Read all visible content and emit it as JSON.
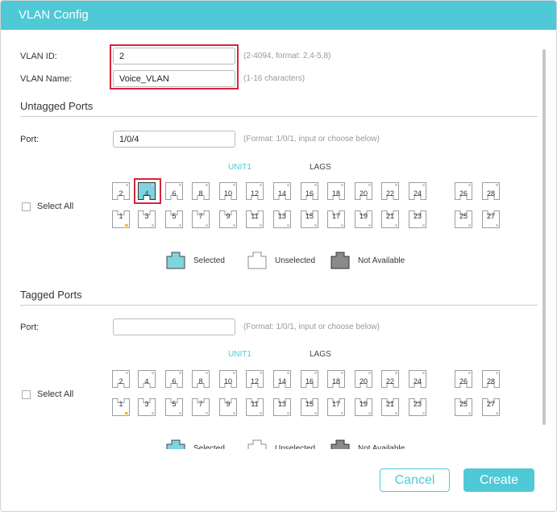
{
  "dialog": {
    "title": "VLAN Config"
  },
  "vlan_id": {
    "label": "VLAN ID:",
    "value": "2",
    "hint": "(2-4094, format: 2,4-5,8)"
  },
  "vlan_name": {
    "label": "VLAN Name:",
    "value": "Voice_VLAN",
    "hint": "(1-16 characters)"
  },
  "untagged": {
    "title": "Untagged Ports",
    "port_label": "Port:",
    "port_value": "1/0/4",
    "port_hint": "(Format: 1/0/1, input or choose below)",
    "select_all": "Select All",
    "unit_label": "UNIT1",
    "lags_label": "LAGS",
    "top_ports": [
      "2",
      "4",
      "6",
      "8",
      "10",
      "12",
      "14",
      "16",
      "18",
      "20",
      "22",
      "24",
      "26",
      "28"
    ],
    "bottom_ports": [
      "1",
      "3",
      "5",
      "7",
      "9",
      "11",
      "13",
      "15",
      "17",
      "19",
      "21",
      "23",
      "25",
      "27"
    ],
    "selected_port": "4"
  },
  "legend": {
    "selected": "Selected",
    "unselected": "Unselected",
    "not_available": "Not Available"
  },
  "tagged": {
    "title": "Tagged Ports",
    "port_label": "Port:",
    "port_value": "",
    "port_hint": "(Format: 1/0/1, input or choose below)",
    "select_all": "Select All",
    "unit_label": "UNIT1",
    "lags_label": "LAGS",
    "top_ports": [
      "2",
      "4",
      "6",
      "8",
      "10",
      "12",
      "14",
      "16",
      "18",
      "20",
      "22",
      "24",
      "26",
      "28"
    ],
    "bottom_ports": [
      "1",
      "3",
      "5",
      "7",
      "9",
      "11",
      "13",
      "15",
      "17",
      "19",
      "21",
      "23",
      "25",
      "27"
    ]
  },
  "buttons": {
    "cancel": "Cancel",
    "create": "Create"
  },
  "colors": {
    "accent": "#4ec9d5",
    "highlight": "#d4263a",
    "unavailable": "#8a8a8a",
    "port_marker": "#f2b300"
  }
}
